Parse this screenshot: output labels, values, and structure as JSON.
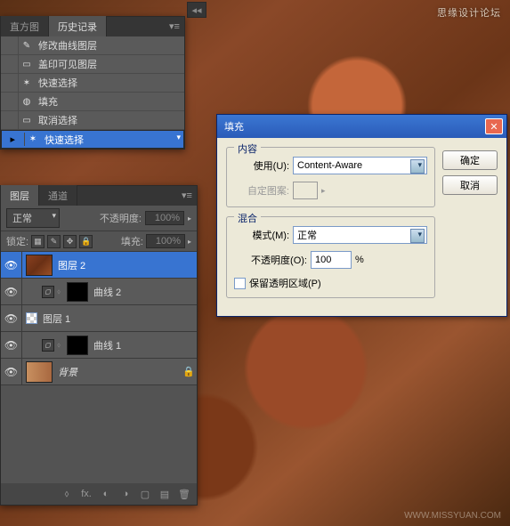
{
  "watermark": "思缘设计论坛",
  "watermark2": "WWW.MISSYUAN.COM",
  "history": {
    "tabs": [
      "直方图",
      "历史记录"
    ],
    "activeTab": 1,
    "items": [
      {
        "icon": "✎",
        "label": "修改曲线图层"
      },
      {
        "icon": "▭",
        "label": "盖印可见图层"
      },
      {
        "icon": "✶",
        "label": "快速选择"
      },
      {
        "icon": "◍",
        "label": "填充"
      },
      {
        "icon": "▭",
        "label": "取消选择"
      },
      {
        "icon": "✶",
        "label": "快速选择"
      }
    ],
    "selectedIndex": 5
  },
  "layers": {
    "tabs": [
      "图层",
      "通道"
    ],
    "activeTab": 0,
    "blendLabel": "正常",
    "opacityLabel": "不透明度:",
    "opacityValue": "100%",
    "lockLabel": "锁定:",
    "fillLabel": "填充:",
    "fillValue": "100%",
    "items": [
      {
        "name": "图层 2",
        "type": "leaf",
        "selected": true
      },
      {
        "name": "曲线 2",
        "type": "curve"
      },
      {
        "name": "图层 1",
        "type": "chk"
      },
      {
        "name": "曲线 1",
        "type": "curve"
      },
      {
        "name": "背景",
        "type": "bg",
        "locked": true
      }
    ]
  },
  "dialog": {
    "title": "填充",
    "ok": "确定",
    "cancel": "取消",
    "content": {
      "legend": "内容",
      "useLabel": "使用(U):",
      "useValue": "Content-Aware",
      "patternLabel": "自定图案:"
    },
    "blending": {
      "legend": "混合",
      "modeLabel": "模式(M):",
      "modeValue": "正常",
      "opacityLabel": "不透明度(O):",
      "opacityValue": "100",
      "opacityUnit": "%",
      "preserveLabel": "保留透明区域(P)"
    }
  }
}
